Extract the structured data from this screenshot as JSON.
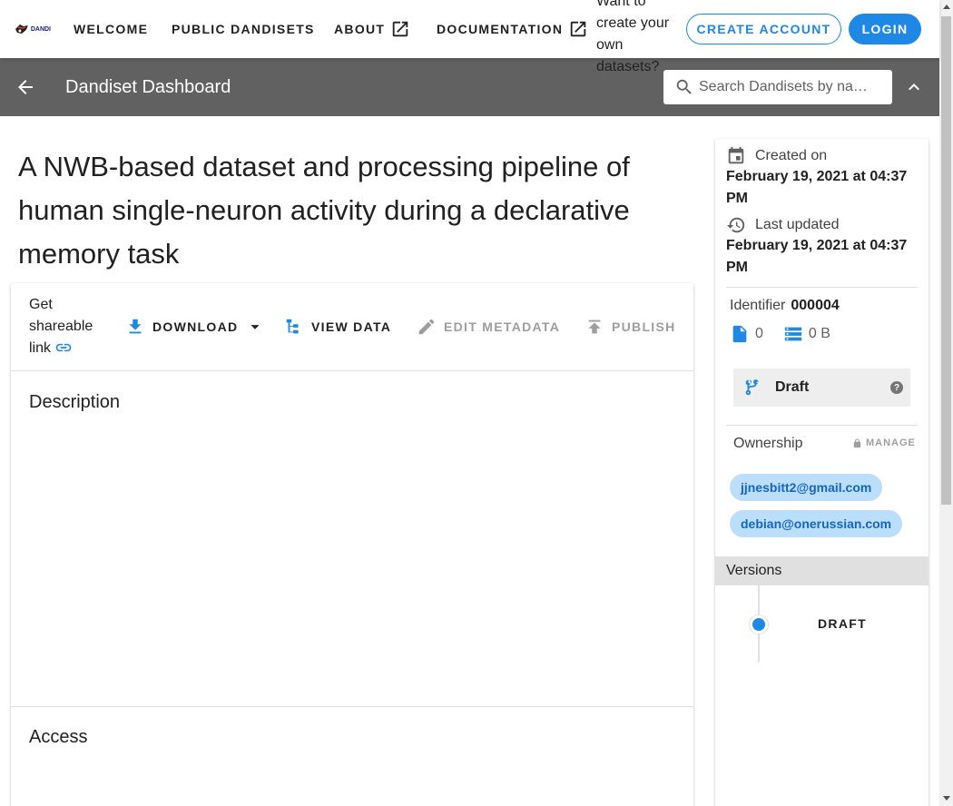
{
  "nav": {
    "logo_text": "DANDI",
    "welcome": "WELCOME",
    "public_dandisets": "PUBLIC DANDISETS",
    "about": "ABOUT",
    "documentation": "DOCUMENTATION",
    "want_text": "Want to create your own datasets?",
    "create_account": "CREATE ACCOUNT",
    "login": "LOGIN"
  },
  "dashbar": {
    "title": "Dandiset Dashboard",
    "search_placeholder": "Search Dandisets by na…"
  },
  "dandiset": {
    "title": "A NWB-based dataset and processing pipeline of human single-neuron activity during a declarative memory task"
  },
  "toolbar": {
    "share": "Get shareable link",
    "download": "DOWNLOAD",
    "view_data": "VIEW DATA",
    "edit_metadata": "EDIT METADATA",
    "publish": "PUBLISH"
  },
  "sections": {
    "description": "Description",
    "access": "Access"
  },
  "side": {
    "created_label": "Created on",
    "created_date": "February 19, 2021 at 04:37 PM",
    "updated_label": "Last updated",
    "updated_date": "February 19, 2021 at 04:37 PM",
    "identifier_label": "Identifier",
    "identifier_value": "000004",
    "file_count": "0",
    "size": "0 B",
    "draft": "Draft",
    "help": "?",
    "ownership_label": "Ownership",
    "manage": "MANAGE",
    "owners": [
      "jjnesbitt2@gmail.com",
      "debian@onerussian.com"
    ],
    "versions_label": "Versions",
    "version_draft": "DRAFT"
  },
  "colors": {
    "accent": "#1e88e5",
    "dashbar": "#616161",
    "chip_bg": "#bbdefb"
  }
}
